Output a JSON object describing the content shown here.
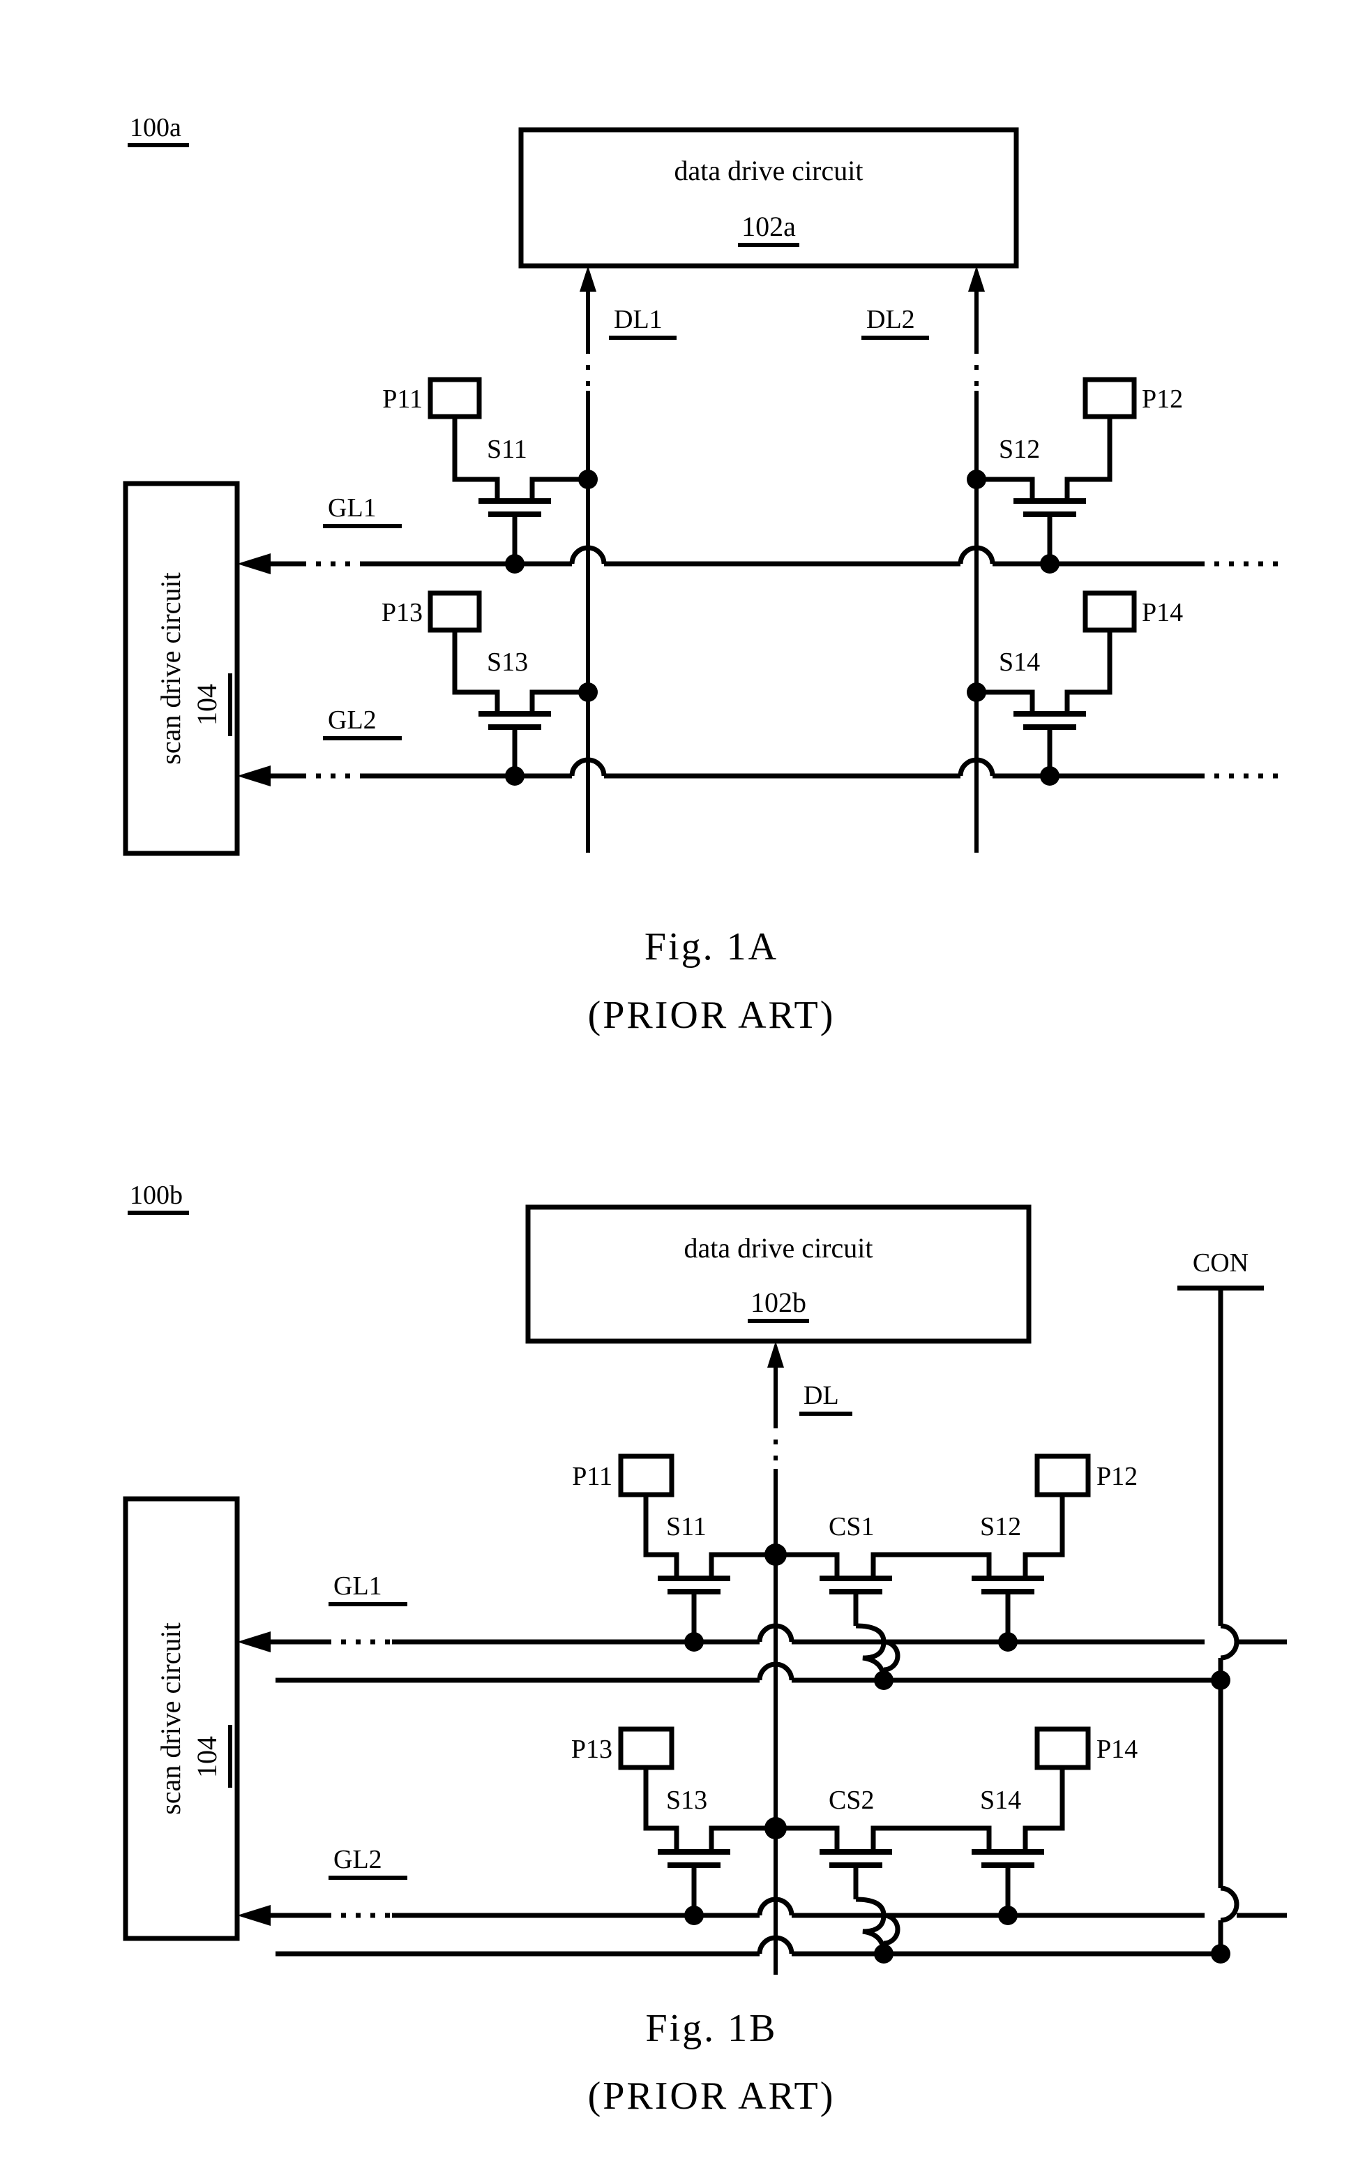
{
  "document": {
    "type": "patent-drawing-sheet",
    "figure_count": 2
  },
  "figures": [
    {
      "id": "fig-1a",
      "ref": "100a",
      "caption_main": "Fig.   1A",
      "caption_sub": "(PRIOR ART)",
      "data_drive": {
        "title": "data drive circuit",
        "ref": "102a"
      },
      "scan_drive": {
        "title": "scan drive circuit",
        "ref": "104"
      },
      "data_lines": [
        {
          "label": "DL1"
        },
        {
          "label": "DL2"
        }
      ],
      "gate_lines": [
        {
          "label": "GL1"
        },
        {
          "label": "GL2"
        }
      ],
      "pixels": [
        {
          "label": "P11"
        },
        {
          "label": "P12"
        },
        {
          "label": "P13"
        },
        {
          "label": "P14"
        }
      ],
      "switches": [
        {
          "label": "S11"
        },
        {
          "label": "S12"
        },
        {
          "label": "S13"
        },
        {
          "label": "S14"
        }
      ]
    },
    {
      "id": "fig-1b",
      "ref": "100b",
      "caption_main": "Fig.   1B",
      "caption_sub": "(PRIOR ART)",
      "data_drive": {
        "title": "data drive circuit",
        "ref": "102b"
      },
      "scan_drive": {
        "title": "scan drive circuit",
        "ref": "104"
      },
      "data_lines": [
        {
          "label": "DL"
        }
      ],
      "control_line": {
        "label": "CON"
      },
      "gate_lines": [
        {
          "label": "GL1"
        },
        {
          "label": "GL2"
        }
      ],
      "pixels": [
        {
          "label": "P11"
        },
        {
          "label": "P12"
        },
        {
          "label": "P13"
        },
        {
          "label": "P14"
        }
      ],
      "switches": [
        {
          "label": "S11"
        },
        {
          "label": "S12"
        },
        {
          "label": "S13"
        },
        {
          "label": "S14"
        }
      ],
      "control_switches": [
        {
          "label": "CS1"
        },
        {
          "label": "CS2"
        }
      ]
    }
  ],
  "colors": {
    "ink": "#000000",
    "paper": "#ffffff"
  }
}
